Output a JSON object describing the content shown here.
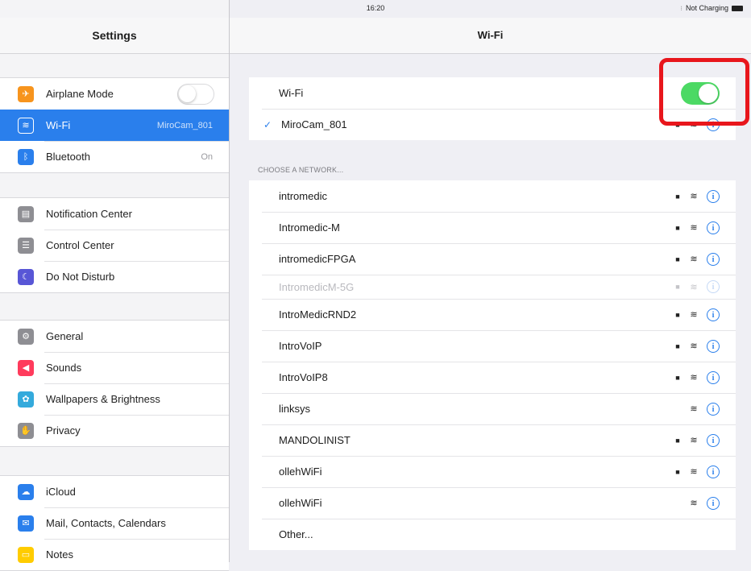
{
  "status_bar": {
    "device": "iPad",
    "time": "16:20",
    "charging": "Not Charging"
  },
  "left": {
    "title": "Settings",
    "groups": [
      [
        {
          "label": "Airplane Mode",
          "icon": "airplane-icon",
          "color": "#f7941d",
          "toggle": "off"
        },
        {
          "label": "Wi-Fi",
          "value": "MiroCam_801",
          "icon": "wifi-icon",
          "color": "#2a7fec",
          "selected": true
        },
        {
          "label": "Bluetooth",
          "value": "On",
          "icon": "bluetooth-icon",
          "color": "#2a7fec"
        }
      ],
      [
        {
          "label": "Notification Center",
          "icon": "notification-center-icon",
          "color": "#8e8e93"
        },
        {
          "label": "Control Center",
          "icon": "control-center-icon",
          "color": "#8e8e93"
        },
        {
          "label": "Do Not Disturb",
          "icon": "moon-icon",
          "color": "#5856d6"
        }
      ],
      [
        {
          "label": "General",
          "icon": "gear-icon",
          "color": "#8e8e93"
        },
        {
          "label": "Sounds",
          "icon": "speaker-icon",
          "color": "#ff3b5c"
        },
        {
          "label": "Wallpapers & Brightness",
          "icon": "wallpaper-icon",
          "color": "#34aadc"
        },
        {
          "label": "Privacy",
          "icon": "hand-icon",
          "color": "#8e8e93"
        }
      ],
      [
        {
          "label": "iCloud",
          "icon": "cloud-icon",
          "color": "#2a7fec"
        },
        {
          "label": "Mail, Contacts, Calendars",
          "icon": "mail-icon",
          "color": "#2a7fec"
        },
        {
          "label": "Notes",
          "icon": "notes-icon",
          "color": "#ffcc00"
        }
      ]
    ]
  },
  "right": {
    "title": "Wi-Fi",
    "wifi_label": "Wi-Fi",
    "wifi_toggle": "on",
    "connected_network": "MiroCam_801",
    "section_header": "CHOOSE A NETWORK...",
    "networks": [
      {
        "name": "intromedic",
        "locked": true
      },
      {
        "name": "Intromedic-M",
        "locked": true
      },
      {
        "name": "intromedicFPGA",
        "locked": true
      },
      {
        "name": "IntromedicM-5G",
        "locked": true,
        "faded": true
      },
      {
        "name": "IntroMedicRND2",
        "locked": true
      },
      {
        "name": "IntroVoIP",
        "locked": true
      },
      {
        "name": "IntroVoIP8",
        "locked": true
      },
      {
        "name": "linksys",
        "locked": false
      },
      {
        "name": "MANDOLINIST",
        "locked": true
      },
      {
        "name": "ollehWiFi",
        "locked": true
      },
      {
        "name": "ollehWiFi",
        "locked": false
      }
    ],
    "other_label": "Other...",
    "accent_color": "#2a7fec",
    "highlight_color": "#e8161c"
  }
}
